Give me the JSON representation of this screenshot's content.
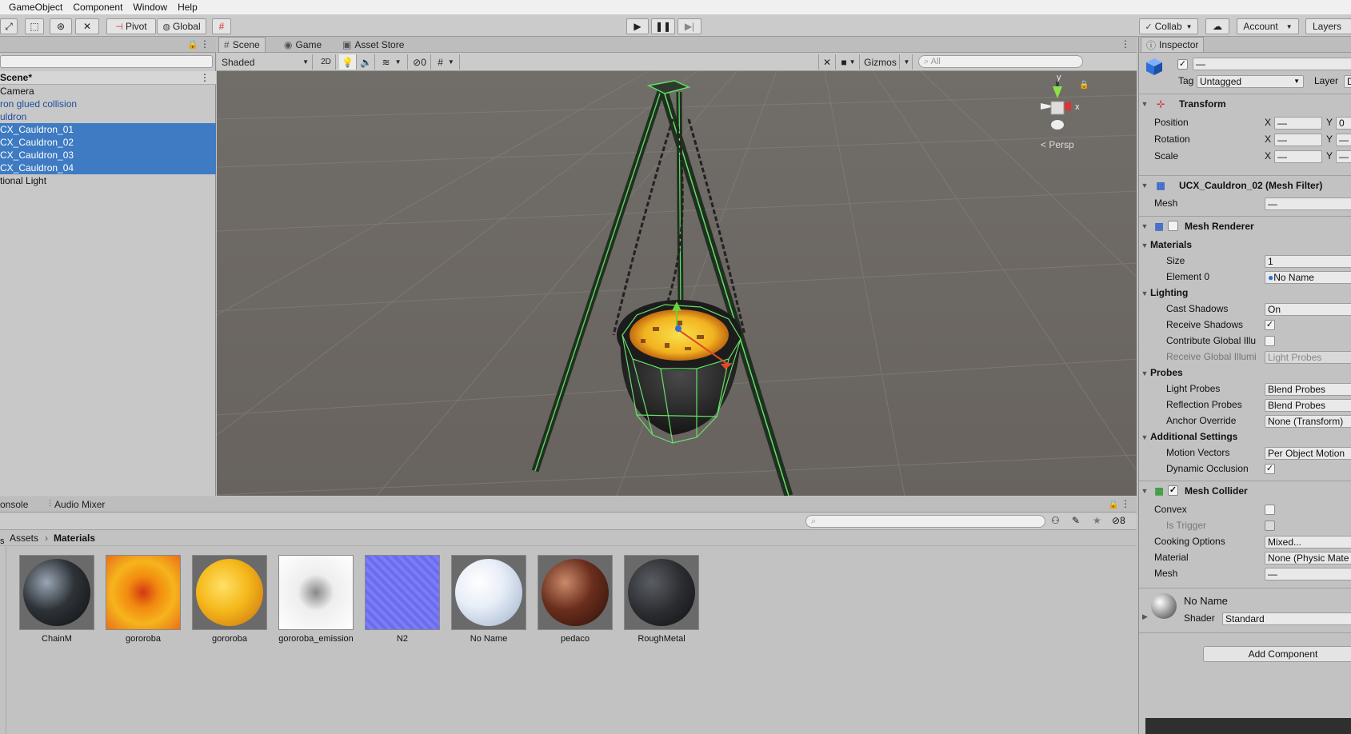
{
  "menu": [
    "GameObject",
    "Component",
    "Window",
    "Help"
  ],
  "toolbar": {
    "pivot": "Pivot",
    "global": "Global",
    "collab": "Collab",
    "account": "Account",
    "layers": "Layers"
  },
  "hierarchy": {
    "title": "Scene*",
    "items": [
      {
        "label": "Camera",
        "state": "normal"
      },
      {
        "label": "ron glued collision",
        "state": "blue"
      },
      {
        "label": "uldron",
        "state": "blue"
      },
      {
        "label": "CX_Cauldron_01",
        "state": "selected"
      },
      {
        "label": "CX_Cauldron_02",
        "state": "selected"
      },
      {
        "label": "CX_Cauldron_03",
        "state": "selected"
      },
      {
        "label": "CX_Cauldron_04",
        "state": "selected"
      },
      {
        "label": "tional Light",
        "state": "normal"
      }
    ]
  },
  "scene": {
    "tabs": [
      "Scene",
      "Game",
      "Asset Store"
    ],
    "shading": "Shaded",
    "mode_2d": "2D",
    "hidden_count": "0",
    "gizmos": "Gizmos",
    "search_placeholder": "All",
    "persp": "Persp",
    "axis_y": "y",
    "axis_x": "x"
  },
  "inspector": {
    "tab": "Inspector",
    "name_value": "—",
    "tag_label": "Tag",
    "tag_value": "Untagged",
    "layer_label": "Layer",
    "layer_value": "D",
    "transform": {
      "title": "Transform",
      "rows": [
        {
          "label": "Position",
          "x": "—",
          "y": "0"
        },
        {
          "label": "Rotation",
          "x": "—",
          "y": "—"
        },
        {
          "label": "Scale",
          "x": "—",
          "y": "—"
        }
      ],
      "x_label": "X",
      "y_label": "Y"
    },
    "mesh_filter": {
      "title": "UCX_Cauldron_02 (Mesh Filter)",
      "mesh_label": "Mesh",
      "mesh_value": "—"
    },
    "mesh_renderer": {
      "title": "Mesh Renderer",
      "materials": "Materials",
      "size_label": "Size",
      "size_value": "1",
      "element0_label": "Element 0",
      "element0_value": "No Name",
      "lighting": "Lighting",
      "cast_shadows_label": "Cast Shadows",
      "cast_shadows_value": "On",
      "receive_shadows_label": "Receive Shadows",
      "contribute_gi_label": "Contribute Global Illu",
      "receive_gi_label": "Receive Global Illumi",
      "receive_gi_value": "Light Probes",
      "probes": "Probes",
      "light_probes_label": "Light Probes",
      "light_probes_value": "Blend Probes",
      "reflection_probes_label": "Reflection Probes",
      "reflection_probes_value": "Blend Probes",
      "anchor_override_label": "Anchor Override",
      "anchor_override_value": "None (Transform)",
      "additional": "Additional Settings",
      "motion_vectors_label": "Motion Vectors",
      "motion_vectors_value": "Per Object Motion",
      "dynamic_occlusion_label": "Dynamic Occlusion"
    },
    "mesh_collider": {
      "title": "Mesh Collider",
      "convex_label": "Convex",
      "trigger_label": "Is Trigger",
      "cooking_label": "Cooking Options",
      "cooking_value": "Mixed...",
      "material_label": "Material",
      "material_value": "None (Physic Mate",
      "mesh_label": "Mesh",
      "mesh_value": "—"
    },
    "material": {
      "name": "No Name",
      "shader_label": "Shader",
      "shader_value": "Standard"
    },
    "add_component": "Add Component"
  },
  "bottom": {
    "tabs": [
      "onsole",
      "Audio Mixer"
    ],
    "breadcrumb_root": "Assets",
    "breadcrumb_current": "Materials",
    "left_label": "s",
    "count": "8",
    "assets": [
      {
        "name": "ChainM",
        "color": "#2e3338"
      },
      {
        "name": "gororoba",
        "color": "#f28a10"
      },
      {
        "name": "gororoba",
        "color": "#f5b81a"
      },
      {
        "name": "gororoba_emission",
        "color": "#f4f4f4"
      },
      {
        "name": "N2",
        "color": "#6a6cf0"
      },
      {
        "name": "No Name",
        "color": "#e8eef8"
      },
      {
        "name": "pedaco",
        "color": "#6a2e1c"
      },
      {
        "name": "RoughMetal",
        "color": "#2b2d31"
      }
    ]
  }
}
